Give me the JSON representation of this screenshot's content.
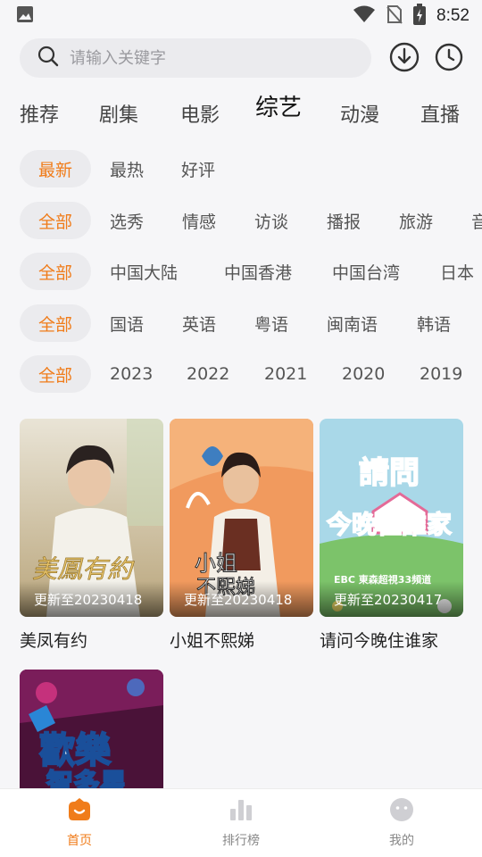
{
  "status_bar": {
    "time": "8:52"
  },
  "search": {
    "placeholder": "请输入关键字"
  },
  "main_tabs": [
    {
      "label": "推荐",
      "active": false
    },
    {
      "label": "剧集",
      "active": false
    },
    {
      "label": "电影",
      "active": false
    },
    {
      "label": "综艺",
      "active": true
    },
    {
      "label": "动漫",
      "active": false
    },
    {
      "label": "直播",
      "active": false
    }
  ],
  "filters": {
    "sort": [
      "最新",
      "最热",
      "好评"
    ],
    "genre": [
      "全部",
      "选秀",
      "情感",
      "访谈",
      "播报",
      "旅游",
      "音"
    ],
    "region": [
      "全部",
      "中国大陆",
      "中国香港",
      "中国台湾",
      "日本"
    ],
    "language": [
      "全部",
      "国语",
      "英语",
      "粤语",
      "闽南语",
      "韩语"
    ],
    "year": [
      "全部",
      "2023",
      "2022",
      "2021",
      "2020",
      "2019"
    ]
  },
  "cards": [
    {
      "title": "美凤有约",
      "update": "更新至20230418",
      "poster_text": "美鳳有約"
    },
    {
      "title": "小姐不熙娣",
      "update": "更新至20230418",
      "poster_text": "小姐不熙娣"
    },
    {
      "title": "请问今晚住谁家",
      "update": "更新至20230417",
      "poster_text": "請問今晚住誰家",
      "channel_text": "EBC 東森超視33頻道"
    },
    {
      "title": "",
      "update": "",
      "poster_text": "歡樂智多星"
    }
  ],
  "tabbar": [
    {
      "label": "首页",
      "icon": "home-icon",
      "active": true
    },
    {
      "label": "排行榜",
      "icon": "ranking-icon",
      "active": false
    },
    {
      "label": "我的",
      "icon": "profile-icon",
      "active": false
    }
  ],
  "colors": {
    "accent": "#f07c1a",
    "chip_bg": "#ebebee",
    "background": "#f6f6f8"
  }
}
